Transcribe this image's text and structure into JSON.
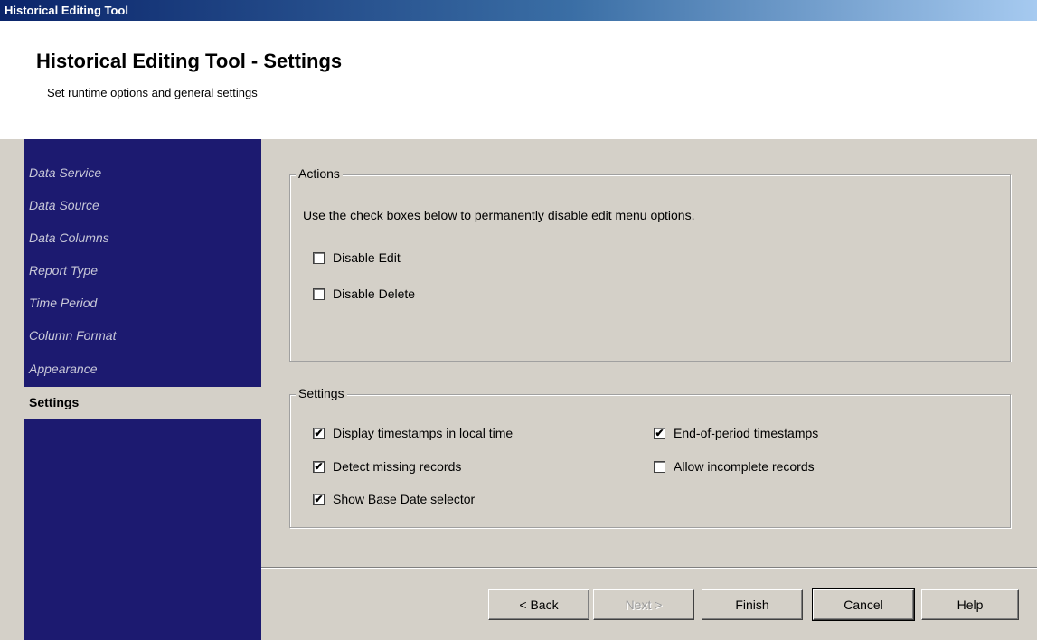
{
  "window": {
    "title": "Historical Editing Tool"
  },
  "header": {
    "title": "Historical Editing Tool - Settings",
    "subtitle": "Set runtime options and general settings"
  },
  "sidebar": {
    "items": [
      {
        "label": "Data Service",
        "active": false
      },
      {
        "label": "Data Source",
        "active": false
      },
      {
        "label": "Data Columns",
        "active": false
      },
      {
        "label": "Report Type",
        "active": false
      },
      {
        "label": "Time Period",
        "active": false
      },
      {
        "label": "Column Format",
        "active": false
      },
      {
        "label": "Appearance",
        "active": false
      },
      {
        "label": "Settings",
        "active": true
      }
    ]
  },
  "actions": {
    "legend": "Actions",
    "description": "Use the check boxes below to permanently disable edit menu options.",
    "disable_edit": {
      "label": "Disable Edit",
      "checked": false
    },
    "disable_delete": {
      "label": "Disable Delete",
      "checked": false
    }
  },
  "settings": {
    "legend": "Settings",
    "local_time": {
      "label": "Display timestamps in local time",
      "checked": true
    },
    "detect_missing": {
      "label": "Detect missing records",
      "checked": true
    },
    "base_date": {
      "label": "Show Base Date selector",
      "checked": true
    },
    "end_of_period": {
      "label": "End-of-period timestamps",
      "checked": true
    },
    "allow_incomplete": {
      "label": "Allow incomplete records",
      "checked": false
    }
  },
  "buttons": {
    "back": "< Back",
    "next": "Next >",
    "finish": "Finish",
    "cancel": "Cancel",
    "help": "Help"
  },
  "colors": {
    "sidebar_bg": "#1c1a70",
    "panel_bg": "#d4d0c8",
    "title_bar_start": "#0a246a"
  }
}
